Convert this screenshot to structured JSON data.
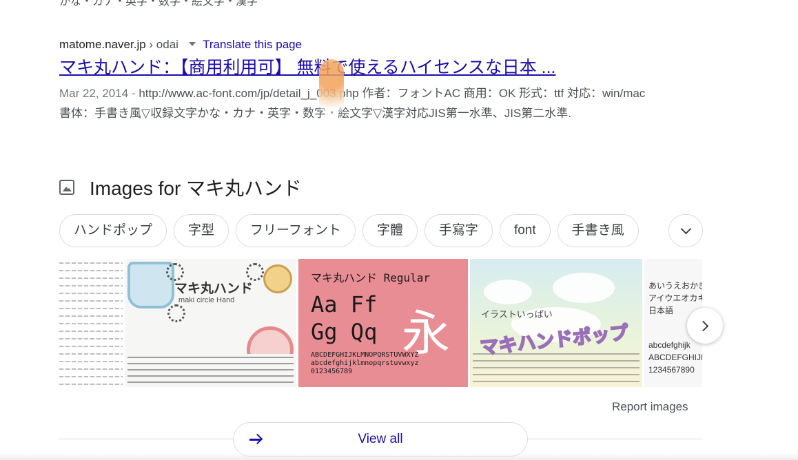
{
  "top_cut_text": "かな・カナ・英字・数字・絵文字・漢字",
  "result": {
    "domain": "matome.naver.jp",
    "breadcrumb": "› odai",
    "translate_link": "Translate this page",
    "title": "マキ丸ハンド：【商用利用可】 無料で使えるハイセンスな日本 ...",
    "date": "Mar 22, 2014",
    "snippet": "http://www.ac-font.com/jp/detail_j_003.php 作者：フォントAC 商用：OK 形式：ttf 対応：win/mac 書体：手書き風▽収録文字かな・カナ・英字・数字・絵文字▽漢字対応JIS第一水準、JIS第二水準."
  },
  "images": {
    "title": "Images for マキ丸ハンド",
    "chips": [
      "ハンドポップ",
      "字型",
      "フリーフォント",
      "字體",
      "手寫字",
      "font",
      "手書き風"
    ],
    "thumbnails": {
      "t2_title": "マキ丸ハンド",
      "t2_sub": "maki circle Hand",
      "t3_header": "マキ丸ハンド Regular",
      "t3_big_line1": "Aa Ff",
      "t3_big_line2": "Gg Qq",
      "t3_kanji": "永",
      "t3_abc_1": "ABCDEFGHIJKLMNOPQRSTUVWXYZ",
      "t3_abc_2": "abcdefghijklmnopqrstuvwxyz",
      "t3_abc_3": "0123456789",
      "t4_label": "イラストいっぱい",
      "t4_pop": "マキハンドポップ",
      "t5_lines": [
        "あいうえおかき",
        "アイウエオカキ",
        "日本語",
        "abcdefghijk",
        "ABCDEFGHIJK",
        "1234567890"
      ]
    },
    "report_link": "Report images",
    "view_all": "View all"
  },
  "colors": {
    "link": "#1a0dab",
    "text": "#202124",
    "muted": "#4d5156",
    "border": "#dadce0"
  }
}
